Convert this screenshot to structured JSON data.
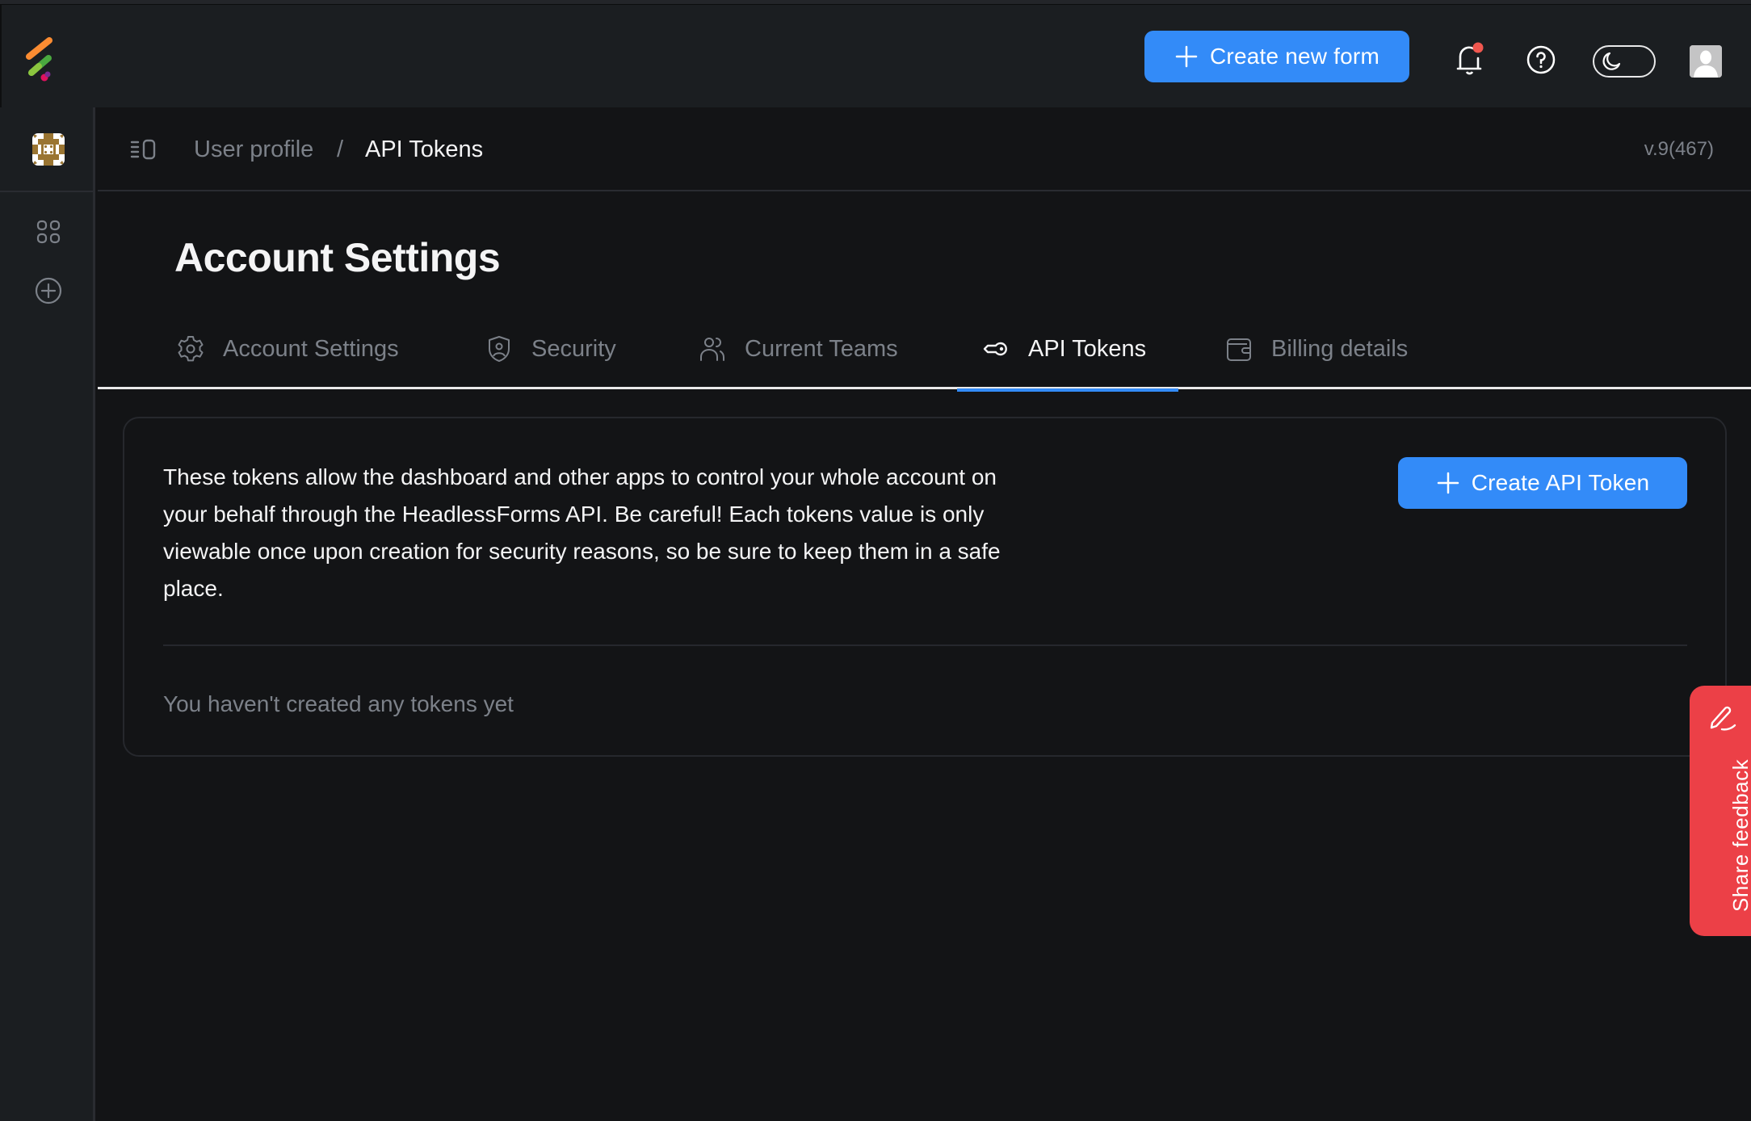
{
  "topbar": {
    "logo": "headlessforms-logo",
    "create_button": {
      "label": "Create new form",
      "icon": "plus-icon"
    },
    "notifications": {
      "icon": "bell-icon",
      "has_unread": true,
      "dot_color": "#f0574f"
    },
    "help": {
      "icon": "help-circle-icon"
    },
    "theme_toggle": {
      "icon": "moon-icon",
      "mode": "dark"
    },
    "user_avatar": {
      "icon": "user-avatar-icon"
    }
  },
  "sidebar": {
    "team_avatar": "team-avatar",
    "items": [
      {
        "name": "dashboard",
        "icon": "grid-icon"
      },
      {
        "name": "add",
        "icon": "plus-circle-icon"
      }
    ]
  },
  "subheader": {
    "panel_toggle_icon": "sidebar-toggle-icon",
    "breadcrumb": [
      {
        "label": "User profile"
      },
      {
        "label": "API Tokens"
      }
    ],
    "separator": "/",
    "version": "v.9(467)"
  },
  "page": {
    "title": "Account Settings",
    "tabs": [
      {
        "label": "Account Settings",
        "icon": "gear-icon",
        "active": false
      },
      {
        "label": "Security",
        "icon": "shield-user-icon",
        "active": false
      },
      {
        "label": "Current Teams",
        "icon": "users-icon",
        "active": false
      },
      {
        "label": "API Tokens",
        "icon": "key-icon",
        "active": true
      },
      {
        "label": "Billing details",
        "icon": "wallet-icon",
        "active": false
      }
    ]
  },
  "tokens_card": {
    "description": "These tokens allow the dashboard and other apps to control your whole account on your behalf through the HeadlessForms API. Be careful! Each tokens value is only viewable once upon creation for security reasons, so be sure to keep them in a safe place.",
    "create_button": {
      "label": "Create API Token",
      "icon": "plus-icon"
    },
    "empty_state": "You haven't created any tokens yet",
    "tokens": []
  },
  "feedback": {
    "label": "Share feedback",
    "icon": "pencil-icon",
    "color": "#ec4047"
  },
  "colors": {
    "accent": "#338bf8",
    "background": "#131416",
    "surface": "#1b1e21",
    "muted_text": "#7c8189",
    "text": "#f4f4f5"
  }
}
